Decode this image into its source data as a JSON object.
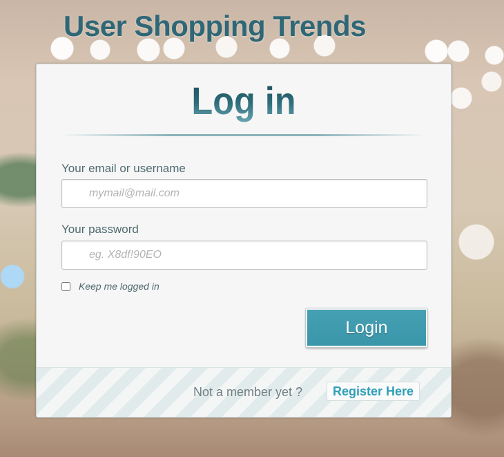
{
  "page": {
    "title": "User Shopping Trends"
  },
  "login_form": {
    "heading": "Log in",
    "email": {
      "label": "Your email or username",
      "value": "",
      "placeholder": "mymail@mail.com"
    },
    "password": {
      "label": "Your password",
      "value": "",
      "placeholder": "eg. X8df!90EO"
    },
    "remember": {
      "label": "Keep me logged in",
      "checked": false
    },
    "submit_label": "Login"
  },
  "footer": {
    "prompt": "Not a member yet ?",
    "register_label": "Register Here"
  },
  "colors": {
    "title": "#2f6776",
    "button": "#3a96aa",
    "link": "#2f9fb8",
    "card_background": "#f6f6f6"
  }
}
